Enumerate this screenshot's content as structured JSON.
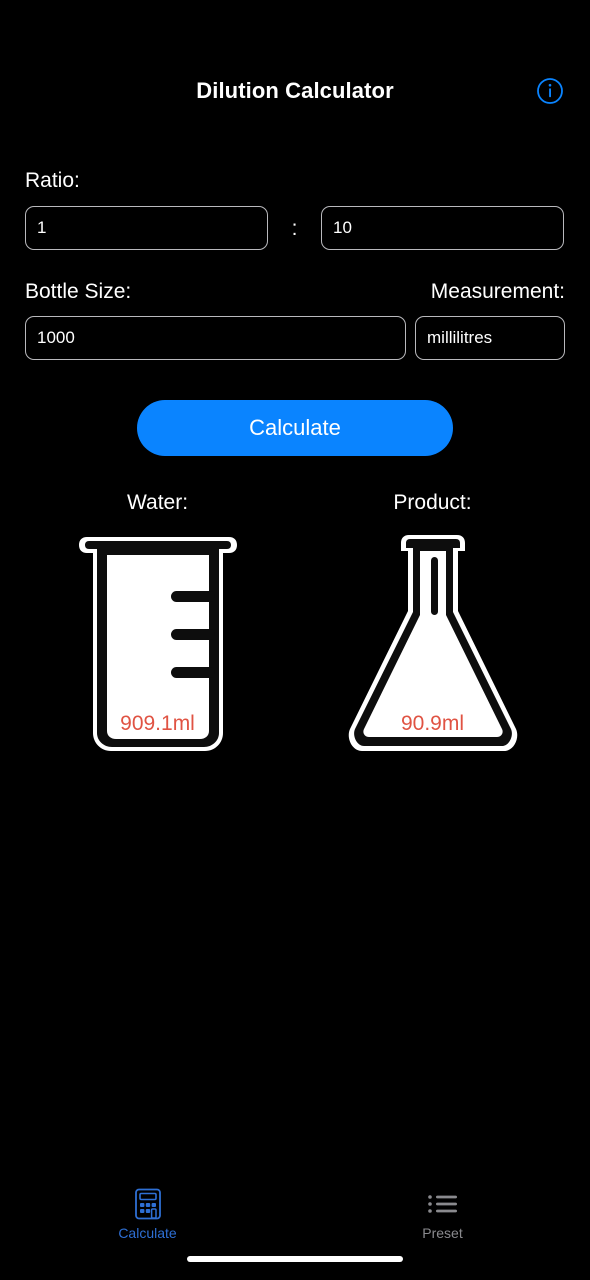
{
  "app": {
    "title": "Dilution Calculator",
    "info_icon": "info-circle-icon"
  },
  "form": {
    "ratio": {
      "label": "Ratio:",
      "separator": ":",
      "left_value": "1",
      "left_placeholder": "1",
      "right_value": "10",
      "right_placeholder": "10"
    },
    "bottle": {
      "label": "Bottle Size:",
      "value": "1000",
      "placeholder": "1000"
    },
    "measurement": {
      "label": "Measurement:",
      "value": "millilitres",
      "placeholder": "millilitres"
    },
    "calculate_button": "Calculate"
  },
  "results": {
    "water": {
      "title": "Water:",
      "amount": "909.1ml",
      "vessel": "beaker-icon"
    },
    "product": {
      "title": "Product:",
      "amount": "90.9ml",
      "vessel": "erlenmeyer-flask-icon"
    }
  },
  "tabbar": {
    "items": [
      {
        "label": "Calculate",
        "icon": "calculator-icon",
        "active": true
      },
      {
        "label": "Preset",
        "icon": "list-bullet-icon",
        "active": false
      }
    ]
  },
  "colors": {
    "background": "#000000",
    "accent_blue": "#0a84ff",
    "tab_active": "#2e6fd4",
    "tab_inactive": "#8a8a8e",
    "result_red": "#e05343",
    "input_border": "#b9b9bd",
    "text": "#ffffff"
  }
}
